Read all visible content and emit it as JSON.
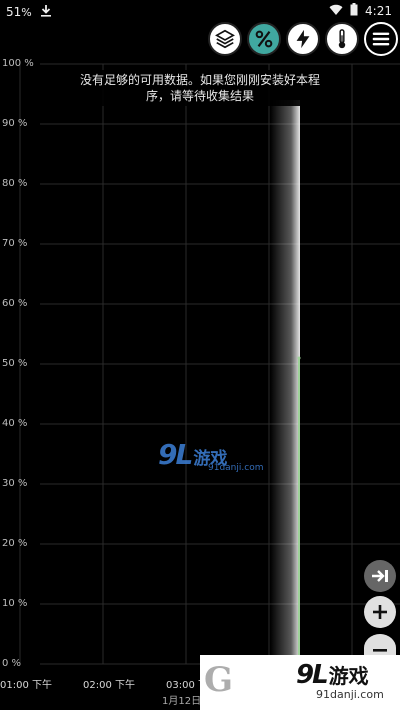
{
  "status_bar": {
    "battery_left": "51",
    "battery_unit": "%",
    "time": "4:21"
  },
  "toolbar": {
    "layers": "layers-icon",
    "percent": "percent-icon",
    "charge": "lightning-icon",
    "temp": "thermometer-icon",
    "menu": "menu-icon",
    "accent_color": "#40a8a0"
  },
  "notice": {
    "text": "没有足够的可用数据。如果您刚刚安装好本程序，请等待收集结果"
  },
  "chart_data": {
    "type": "line",
    "title": "",
    "y_ticks": [
      "100 %",
      "90 %",
      "80 %",
      "70 %",
      "60 %",
      "50 %",
      "40 %",
      "30 %",
      "20 %",
      "10 %",
      "0 %"
    ],
    "x_ticks": [
      "01:00 下午",
      "02:00 下午",
      "03:00 下午"
    ],
    "date_label": "1月12日 - 星期二",
    "ylim": [
      0,
      100
    ],
    "grid": true,
    "series": [
      {
        "values": [
          51
        ],
        "color": "#9fd39a"
      }
    ]
  },
  "watermark": {
    "top_logo": "9L",
    "top_text": "游戏",
    "top_sub": "91danji.com",
    "bottom_logo": "9L",
    "bottom_text": "游戏",
    "bottom_sub": "91danji.com"
  }
}
